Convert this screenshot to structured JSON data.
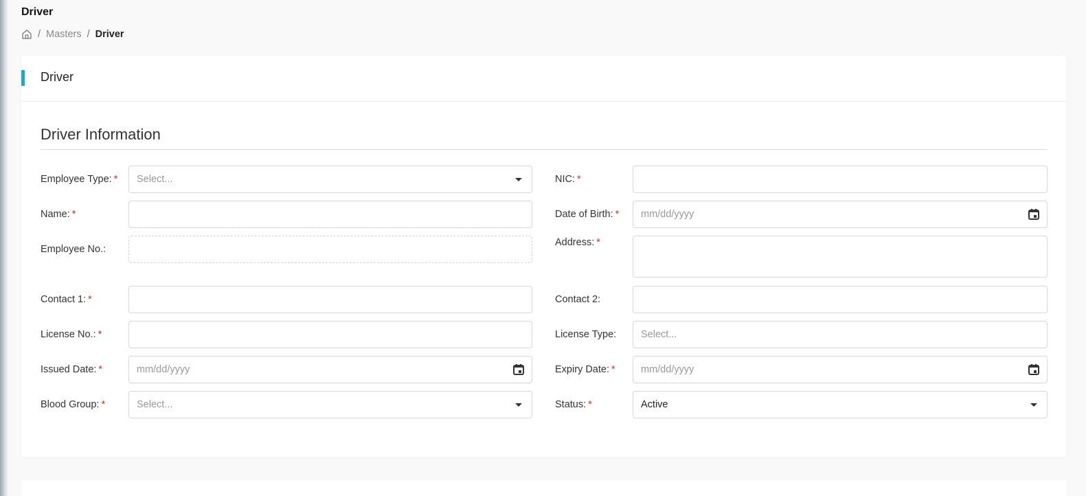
{
  "page": {
    "title": "Driver",
    "breadcrumb": [
      {
        "icon": "home-icon"
      },
      {
        "label": "Masters"
      },
      {
        "label": "Driver"
      }
    ],
    "separator": "/"
  },
  "card": {
    "title": "Driver",
    "accent_color": "#1ba5e0",
    "section_title": "Driver Information"
  },
  "form": {
    "required_marker": "*",
    "employee_type": {
      "label": "Employee Type:",
      "placeholder": "Select...",
      "value": ""
    },
    "nic": {
      "label": "NIC:",
      "value": ""
    },
    "name": {
      "label": "Name:",
      "value": ""
    },
    "date_of_birth": {
      "label": "Date of Birth:",
      "placeholder": "mm/dd/yyyy"
    },
    "employee_no": {
      "label": "Employee No.:",
      "value": ""
    },
    "address": {
      "label": "Address:",
      "value": ""
    },
    "contact1": {
      "label": "Contact 1:",
      "value": ""
    },
    "contact2": {
      "label": "Contact 2:",
      "value": ""
    },
    "license_no": {
      "label": "License No.:",
      "value": ""
    },
    "license_type": {
      "label": "License Type:",
      "placeholder": "Select..."
    },
    "issued_date": {
      "label": "Issued Date:",
      "placeholder": "mm/dd/yyyy"
    },
    "expiry_date": {
      "label": "Expiry Date:",
      "placeholder": "mm/dd/yyyy"
    },
    "blood_group": {
      "label": "Blood Group:",
      "placeholder": "Select..."
    },
    "status": {
      "label": "Status:",
      "value": "Active"
    }
  }
}
